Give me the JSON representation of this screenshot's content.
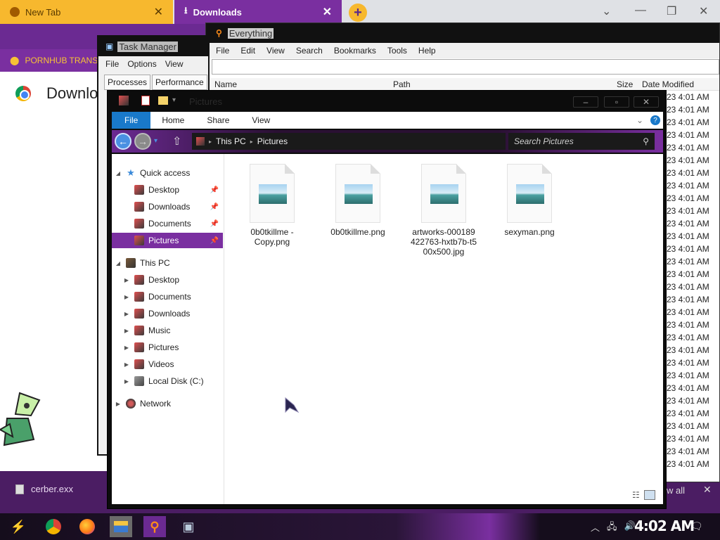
{
  "browser": {
    "tabs": [
      {
        "label": "New Tab",
        "close": "✕"
      },
      {
        "label": "Downloads",
        "close": "✕"
      }
    ],
    "new_tab_symbol": "+",
    "window_controls": {
      "chevron": "⌄",
      "minimize": "—",
      "restore": "❐",
      "close": "✕"
    },
    "bookmark_label": "PORNHUB TRANS",
    "page_heading": "Downlo",
    "download_file": "cerber.exx",
    "download_show_all": "w all",
    "download_close": "✕"
  },
  "everything": {
    "title": "Everything",
    "menu": [
      "File",
      "Edit",
      "View",
      "Search",
      "Bookmarks",
      "Tools",
      "Help"
    ],
    "columns": {
      "name": "Name",
      "path": "Path",
      "size": "Size",
      "date": "Date Modified"
    },
    "times": [
      "23 4:01 AM",
      "23 4:01 AM",
      "23 4:01 AM",
      "23 4:01 AM",
      "23 4:01 AM",
      "23 4:01 AM",
      "23 4:01 AM",
      "23 4:01 AM",
      "23 4:01 AM",
      "23 4:01 AM",
      "23 4:01 AM",
      "23 4:01 AM",
      "23 4:01 AM",
      "23 4:01 AM",
      "23 4:01 AM",
      "23 4:01 AM",
      "23 4:01 AM",
      "23 4:01 AM",
      "23 4:01 AM",
      "23 4:01 AM",
      "23 4:01 AM",
      "23 4:01 AM",
      "23 4:01 AM",
      "23 4:01 AM",
      "23 4:01 AM",
      "23 4:01 AM",
      "23 4:01 AM",
      "23 4:01 AM",
      "23 4:01 AM",
      "23 4:01 AM"
    ]
  },
  "task_manager": {
    "title": "Task Manager",
    "menu": [
      "File",
      "Options",
      "View"
    ],
    "tabs": [
      "Processes",
      "Performance"
    ]
  },
  "explorer": {
    "title": "Pictures",
    "ribbon_tabs": [
      "File",
      "Home",
      "Share",
      "View"
    ],
    "breadcrumb": [
      "This PC",
      "Pictures"
    ],
    "search_placeholder": "Search Pictures",
    "nav": {
      "quick_access": "Quick access",
      "quick_items": [
        "Desktop",
        "Downloads",
        "Documents",
        "Pictures"
      ],
      "this_pc": "This PC",
      "pc_items": [
        "Desktop",
        "Documents",
        "Downloads",
        "Music",
        "Pictures",
        "Videos",
        "Local Disk (C:)"
      ],
      "network": "Network"
    },
    "files": [
      {
        "name": "0b0tkillme - Copy.png"
      },
      {
        "name": "0b0tkillme.png"
      },
      {
        "name": "artworks-000189422763-hxtb7b-t500x500.jpg"
      },
      {
        "name": "sexyman.png"
      }
    ]
  },
  "taskbar": {
    "clock": "4:02 AM",
    "pinned": [
      "start-icon",
      "chrome-icon",
      "firefox-icon",
      "file-explorer-icon",
      "everything-icon",
      "task-manager-icon"
    ]
  },
  "colors": {
    "accent_purple": "#7a2fa0",
    "tab_yellow": "#f7b82e",
    "ribbon_blue": "#1979ca"
  }
}
